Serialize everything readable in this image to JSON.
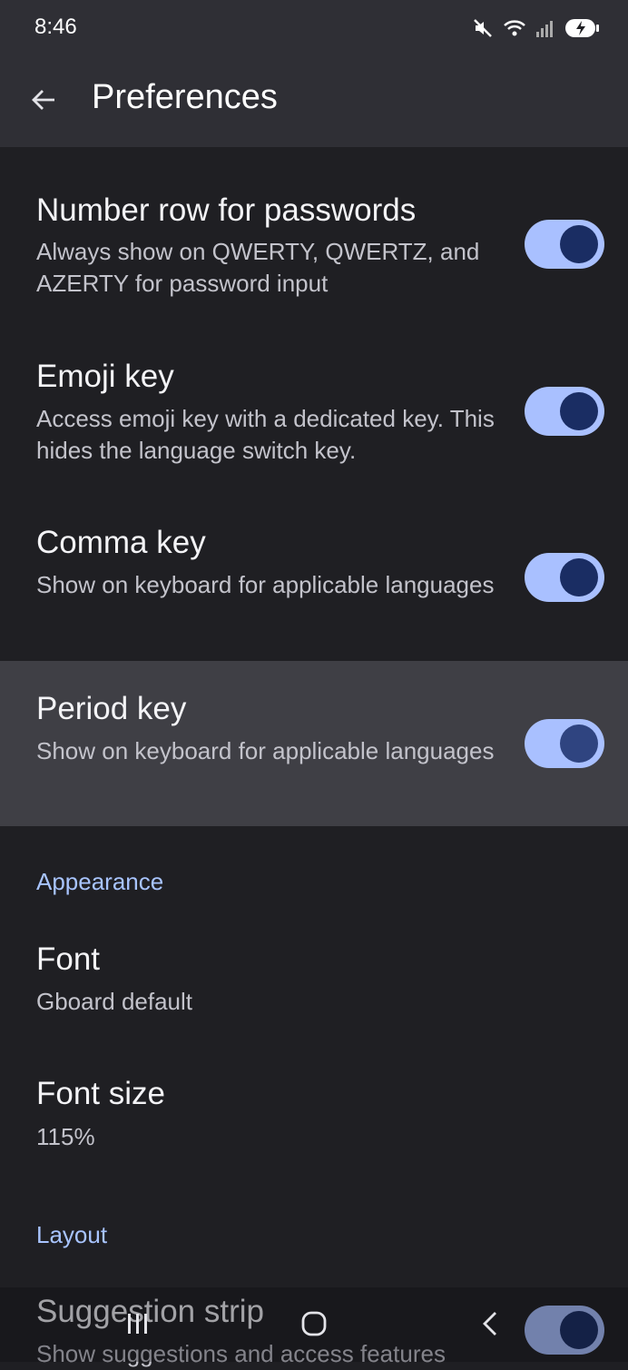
{
  "status_bar": {
    "time": "8:46",
    "icons": [
      "mute-icon",
      "wifi-icon",
      "signal-icon",
      "battery-charging-icon"
    ]
  },
  "app_bar": {
    "title": "Preferences",
    "back_icon": "arrow-back-icon"
  },
  "settings": [
    {
      "title": "Number row for passwords",
      "description": "Always show on QWERTY, QWERTZ, and AZERTY for password input",
      "enabled": true
    },
    {
      "title": "Emoji key",
      "description": "Access emoji key with a dedicated key. This hides the language switch key.",
      "enabled": true
    },
    {
      "title": "Comma key",
      "description": "Show on keyboard for applicable languages",
      "enabled": true
    },
    {
      "title": "Period key",
      "description": "Show on keyboard for applicable languages",
      "enabled": true
    }
  ],
  "appearance": {
    "header": "Appearance",
    "font": {
      "title": "Font",
      "value": "Gboard default"
    },
    "font_size": {
      "title": "Font size",
      "value": "115%"
    }
  },
  "layout": {
    "header": "Layout",
    "suggestion_strip": {
      "title": "Suggestion strip",
      "description": "Show suggestions and access features",
      "enabled": true
    }
  },
  "nav_bar": {
    "icons": [
      "recents-icon",
      "home-icon",
      "back-icon"
    ]
  },
  "colors": {
    "background": "#1f1f23",
    "switch_track": "#a9c0ff",
    "switch_thumb": "#1a2d63",
    "accent_text": "#a8c4ff"
  }
}
